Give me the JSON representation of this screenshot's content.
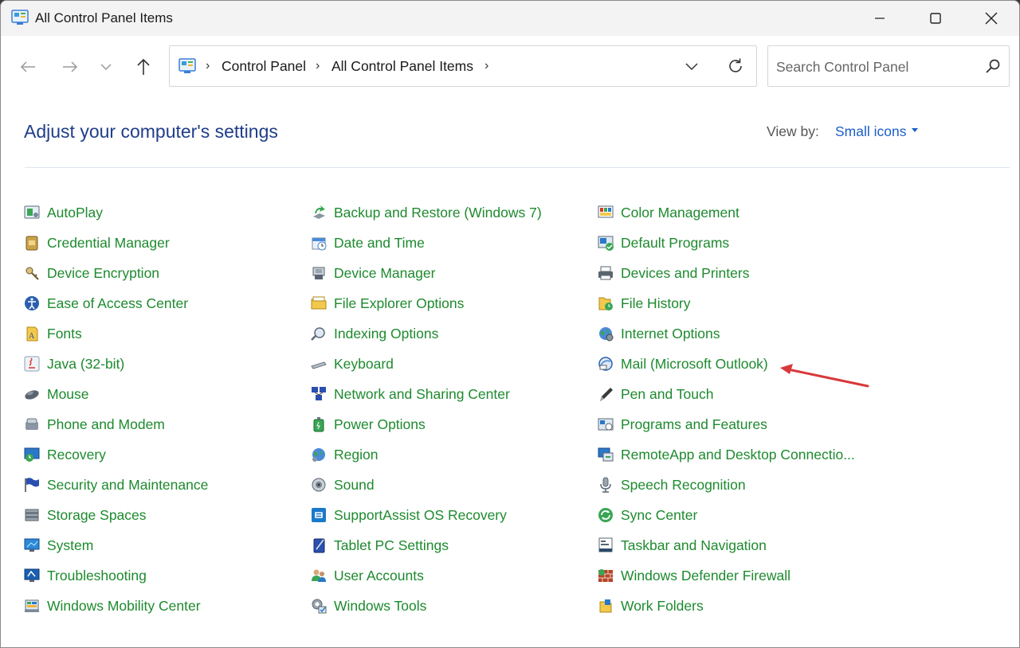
{
  "window": {
    "title": "All Control Panel Items"
  },
  "nav": {
    "breadcrumb": [
      "Control Panel",
      "All Control Panel Items"
    ],
    "search_placeholder": "Search Control Panel"
  },
  "header": {
    "title": "Adjust your computer's settings",
    "view_by_label": "View by:",
    "view_by_value": "Small icons"
  },
  "columns": [
    [
      {
        "label": "AutoPlay",
        "icon": "autoplay-icon"
      },
      {
        "label": "Credential Manager",
        "icon": "credential-manager-icon"
      },
      {
        "label": "Device Encryption",
        "icon": "device-encryption-icon"
      },
      {
        "label": "Ease of Access Center",
        "icon": "ease-of-access-icon"
      },
      {
        "label": "Fonts",
        "icon": "fonts-icon"
      },
      {
        "label": "Java (32-bit)",
        "icon": "java-icon"
      },
      {
        "label": "Mouse",
        "icon": "mouse-icon"
      },
      {
        "label": "Phone and Modem",
        "icon": "phone-modem-icon"
      },
      {
        "label": "Recovery",
        "icon": "recovery-icon"
      },
      {
        "label": "Security and Maintenance",
        "icon": "security-flag-icon"
      },
      {
        "label": "Storage Spaces",
        "icon": "storage-spaces-icon"
      },
      {
        "label": "System",
        "icon": "system-icon"
      },
      {
        "label": "Troubleshooting",
        "icon": "troubleshooting-icon"
      },
      {
        "label": "Windows Mobility Center",
        "icon": "mobility-center-icon"
      }
    ],
    [
      {
        "label": "Backup and Restore (Windows 7)",
        "icon": "backup-restore-icon"
      },
      {
        "label": "Date and Time",
        "icon": "date-time-icon"
      },
      {
        "label": "Device Manager",
        "icon": "device-manager-icon"
      },
      {
        "label": "File Explorer Options",
        "icon": "folder-options-icon"
      },
      {
        "label": "Indexing Options",
        "icon": "indexing-icon"
      },
      {
        "label": "Keyboard",
        "icon": "keyboard-icon"
      },
      {
        "label": "Network and Sharing Center",
        "icon": "network-icon"
      },
      {
        "label": "Power Options",
        "icon": "power-options-icon"
      },
      {
        "label": "Region",
        "icon": "region-globe-icon"
      },
      {
        "label": "Sound",
        "icon": "sound-speaker-icon"
      },
      {
        "label": "SupportAssist OS Recovery",
        "icon": "supportassist-icon"
      },
      {
        "label": "Tablet PC Settings",
        "icon": "tablet-icon"
      },
      {
        "label": "User Accounts",
        "icon": "user-accounts-icon"
      },
      {
        "label": "Windows Tools",
        "icon": "windows-tools-icon"
      }
    ],
    [
      {
        "label": "Color Management",
        "icon": "color-management-icon"
      },
      {
        "label": "Default Programs",
        "icon": "default-programs-icon"
      },
      {
        "label": "Devices and Printers",
        "icon": "printer-icon"
      },
      {
        "label": "File History",
        "icon": "file-history-icon"
      },
      {
        "label": "Internet Options",
        "icon": "internet-options-icon"
      },
      {
        "label": "Mail (Microsoft Outlook)",
        "icon": "mail-icon"
      },
      {
        "label": "Pen and Touch",
        "icon": "pen-icon"
      },
      {
        "label": "Programs and Features",
        "icon": "programs-features-icon"
      },
      {
        "label": "RemoteApp and Desktop Connectio...",
        "icon": "remoteapp-icon"
      },
      {
        "label": "Speech Recognition",
        "icon": "microphone-icon"
      },
      {
        "label": "Sync Center",
        "icon": "sync-center-icon"
      },
      {
        "label": "Taskbar and Navigation",
        "icon": "taskbar-icon"
      },
      {
        "label": "Windows Defender Firewall",
        "icon": "firewall-icon"
      },
      {
        "label": "Work Folders",
        "icon": "work-folders-icon"
      }
    ]
  ],
  "colors": {
    "link": "#1d8a2e",
    "title": "#1f3d8a",
    "accent": "#1c5fc7",
    "annotation_arrow": "#d9383a"
  }
}
